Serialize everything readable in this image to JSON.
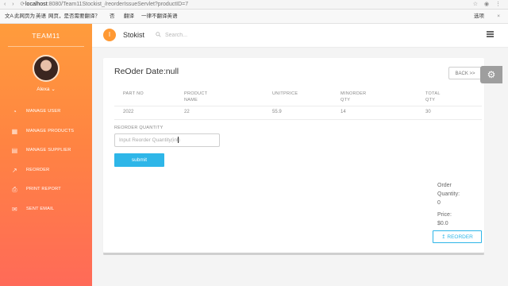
{
  "browser": {
    "host": "localhost",
    "path": ":8080/Team11Stockist_/reorderIssueServlet?productID=7"
  },
  "translate_bar": {
    "page_is": "此网页为",
    "language": "英语",
    "question": "网页，是否需要翻译？",
    "opt_lang": "否",
    "translate": "翻译",
    "never": "一律不翻译英语",
    "options": "选项"
  },
  "sidebar": {
    "brand": "TEAM11",
    "user": "Alexa",
    "items": [
      {
        "label": "MANAGE USER",
        "icon": "pie-chart-icon",
        "glyph": "◔"
      },
      {
        "label": "MANAGE PRODUCTS",
        "icon": "grid-icon",
        "glyph": "▦"
      },
      {
        "label": "MANAGE SUPPLIER",
        "icon": "document-icon",
        "glyph": "▤"
      },
      {
        "label": "REORDER",
        "icon": "chart-line-icon",
        "glyph": "↗"
      },
      {
        "label": "PRINT REPORT",
        "icon": "printer-icon",
        "glyph": "⎙"
      },
      {
        "label": "SENT EMAIL",
        "icon": "envelope-icon",
        "glyph": "✉"
      }
    ]
  },
  "header": {
    "app_name": "Stokist",
    "logo_letter": "I",
    "search_placeholder": "Search..."
  },
  "main": {
    "title": "ReOder Date:null",
    "back_label": "BACK >>",
    "columns": [
      "PART NO",
      "PRODUCT NAME",
      "UNITPRICE",
      "MINORDER QTY",
      "TOTAL QTY"
    ],
    "row": [
      "2022",
      "22",
      "55.9",
      "14",
      "30"
    ],
    "qty_label": "REORDER QUANTITY",
    "qty_placeholder": "Input Reorder Quantity(int)",
    "submit_label": "submit",
    "order_qty_label": "Order Quantity:",
    "order_qty_value": "0",
    "price_label": "Price:",
    "price_value": "$0.0",
    "reorder_label": "REORDER"
  },
  "colors": {
    "sidebar_top": "#ff9c3c",
    "sidebar_bottom": "#ff6a58",
    "accent": "#2eb6e8"
  }
}
